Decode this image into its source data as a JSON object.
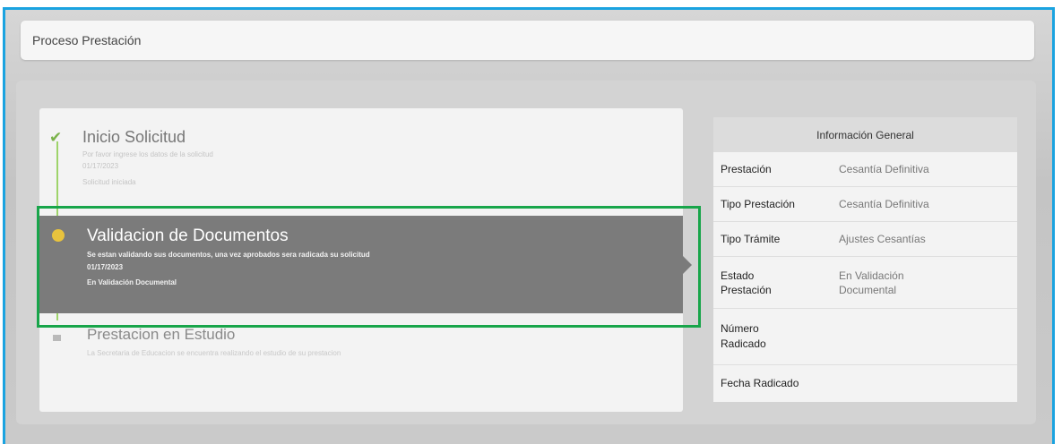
{
  "header": {
    "title": "Proceso Prestación"
  },
  "timeline": {
    "steps": [
      {
        "title": "Inicio Solicitud",
        "description": "Por favor ingrese los datos de la solicitud",
        "date": "01/17/2023",
        "status": "Solicitud iniciada",
        "state": "completed"
      },
      {
        "title": "Validacion de Documentos",
        "description": "Se estan validando sus documentos, una vez aprobados sera radicada su solicitud",
        "date": "01/17/2023",
        "status": "En Validación Documental",
        "state": "active"
      },
      {
        "title": "Prestacion en Estudio",
        "description": "La Secretaria de Educacion se encuentra realizando el estudio de su prestacion",
        "state": "pending"
      }
    ]
  },
  "info": {
    "heading": "Información General",
    "rows": [
      {
        "label": "Prestación",
        "value": "Cesantía Definitiva"
      },
      {
        "label": "Tipo Prestación",
        "value": "Cesantía Definitiva"
      },
      {
        "label": "Tipo Trámite",
        "value": "Ajustes Cesantías"
      },
      {
        "label": "Estado Prestación",
        "value": "En Validación Documental"
      },
      {
        "label": "Número Radicado",
        "value": ""
      },
      {
        "label": "Fecha Radicado",
        "value": ""
      }
    ]
  },
  "colors": {
    "frame_border": "#1aa3e0",
    "highlight_border": "#18a54a",
    "active_bg": "#7b7b7b",
    "active_dot": "#e9c33d",
    "check": "#7ab24a"
  },
  "icons": {
    "completed": "check-icon",
    "active": "dot-icon",
    "pending": "square-icon"
  }
}
